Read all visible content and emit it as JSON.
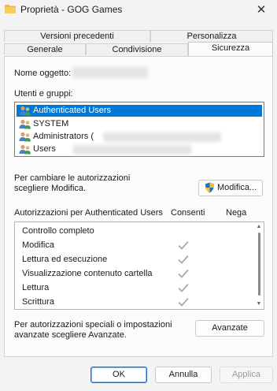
{
  "window": {
    "title": "Proprietà - GOG Games",
    "close_glyph": "✕"
  },
  "tabs": {
    "row1": [
      {
        "label": "Versioni precedenti"
      },
      {
        "label": "Personalizza"
      }
    ],
    "row2": [
      {
        "label": "Generale"
      },
      {
        "label": "Condivisione"
      },
      {
        "label": "Sicurezza",
        "active": true
      }
    ]
  },
  "security": {
    "object_name_label": "Nome oggetto:",
    "groups_label": "Utenti e gruppi:",
    "groups": [
      {
        "label": "Authenticated Users",
        "selected": true,
        "icon": "users-group-icon"
      },
      {
        "label": "SYSTEM",
        "icon": "users-group-icon"
      },
      {
        "label": "Administrators (",
        "icon": "users-group-icon"
      },
      {
        "label": "Users",
        "icon": "users-group-icon"
      }
    ],
    "change_hint_line1": "Per cambiare le autorizzazioni",
    "change_hint_line2": "scegliere Modifica.",
    "modify_button": "Modifica...",
    "permissions_header": "Autorizzazioni per Authenticated Users",
    "allow_header": "Consenti",
    "deny_header": "Nega",
    "permissions": [
      {
        "name": "Controllo completo",
        "allow": false,
        "deny": false
      },
      {
        "name": "Modifica",
        "allow": true,
        "deny": false
      },
      {
        "name": "Lettura ed esecuzione",
        "allow": true,
        "deny": false
      },
      {
        "name": "Visualizzazione contenuto cartella",
        "allow": true,
        "deny": false
      },
      {
        "name": "Lettura",
        "allow": true,
        "deny": false
      },
      {
        "name": "Scrittura",
        "allow": true,
        "deny": false
      }
    ],
    "advanced_hint_line1": "Per autorizzazioni speciali o impostazioni",
    "advanced_hint_line2": "avanzate scegliere Avanzate.",
    "advanced_button": "Avanzate"
  },
  "footer": {
    "ok": "OK",
    "cancel": "Annulla",
    "apply": "Applica"
  },
  "colors": {
    "selection": "#0078d7",
    "check_gray": "#a9a9a9",
    "folder": "#e8b84a",
    "shield_blue": "#1f6fd6",
    "shield_yellow": "#f2c12e"
  }
}
